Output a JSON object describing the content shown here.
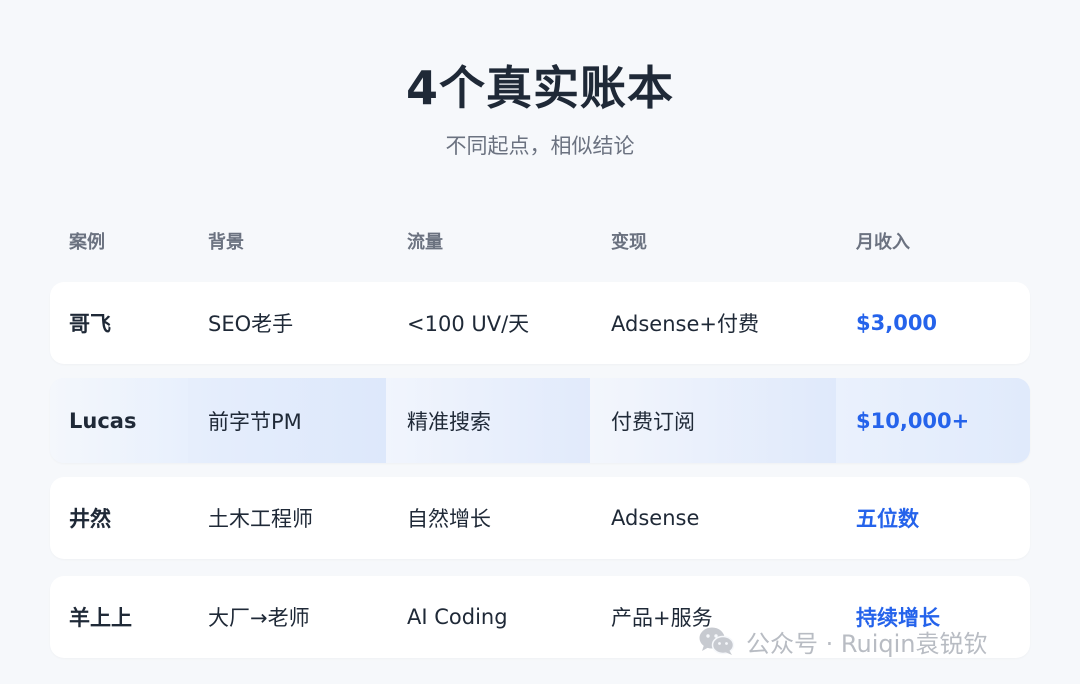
{
  "header": {
    "title": "4个真实账本",
    "subtitle": "不同起点，相似结论"
  },
  "table": {
    "columns": [
      "案例",
      "背景",
      "流量",
      "变现",
      "月收入"
    ],
    "rows": [
      {
        "case": "哥飞",
        "background": "SEO老手",
        "traffic": "<100 UV/天",
        "monetization": "Adsense+付费",
        "income": "$3,000",
        "highlighted": false
      },
      {
        "case": "Lucas",
        "background": "前字节PM",
        "traffic": "精准搜索",
        "monetization": "付费订阅",
        "income": "$10,000+",
        "highlighted": true
      },
      {
        "case": "井然",
        "background": "土木工程师",
        "traffic": "自然增长",
        "monetization": "Adsense",
        "income": "五位数",
        "highlighted": false
      },
      {
        "case": "羊上上",
        "background": "大厂→老师",
        "traffic": "AI Coding",
        "monetization": "产品+服务",
        "income": "持续增长",
        "highlighted": false
      }
    ]
  },
  "watermark": {
    "text": "公众号 · Ruiqin袁锐钦",
    "icon": "wechat-icon"
  },
  "colors": {
    "background": "#f6f8fb",
    "income_accent": "#2563eb",
    "header_text": "#6b7280",
    "highlight_row": "#e4eefd"
  }
}
